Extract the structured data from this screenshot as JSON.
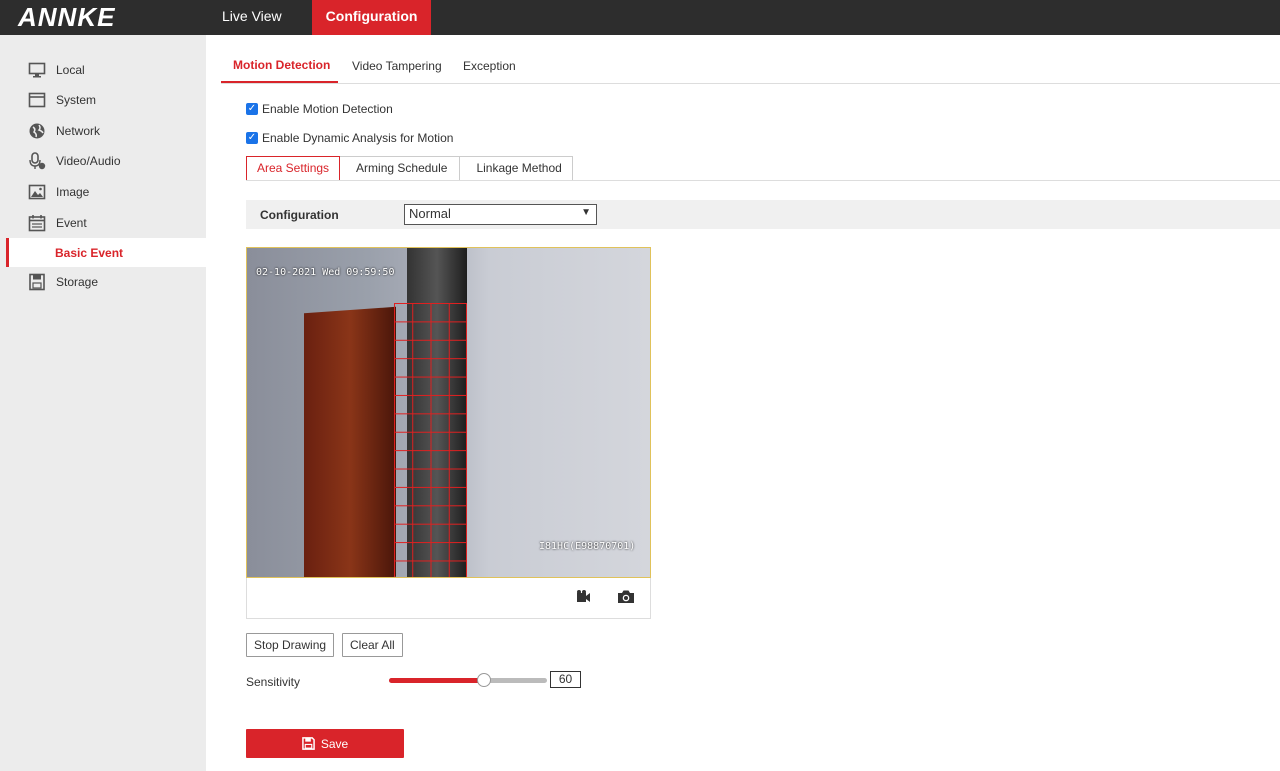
{
  "brand": {
    "logo": "ANNKE"
  },
  "topnav": {
    "live_view": "Live View",
    "configuration": "Configuration"
  },
  "sidebar": {
    "items": [
      {
        "label": "Local",
        "icon": "monitor-icon"
      },
      {
        "label": "System",
        "icon": "system-window-icon"
      },
      {
        "label": "Network",
        "icon": "globe-icon"
      },
      {
        "label": "Video/Audio",
        "icon": "microphone-icon"
      },
      {
        "label": "Image",
        "icon": "image-icon"
      },
      {
        "label": "Event",
        "icon": "calendar-icon"
      }
    ],
    "sub_active": "Basic Event",
    "storage": "Storage"
  },
  "tabs": {
    "motion": "Motion Detection",
    "tampering": "Video Tampering",
    "exception": "Exception"
  },
  "checks": {
    "enable_motion": "Enable Motion Detection",
    "enable_dynamic": "Enable Dynamic Analysis for Motion"
  },
  "subtabs": {
    "area": "Area Settings",
    "arming": "Arming Schedule",
    "linkage": "Linkage Method"
  },
  "config": {
    "label": "Configuration",
    "value": "Normal"
  },
  "video": {
    "timestamp": "02-10-2021 Wed 09:59:50",
    "camera_name": "I81HC(E98870701)"
  },
  "controls": {
    "stop_drawing": "Stop Drawing",
    "clear_all": "Clear All"
  },
  "sensitivity": {
    "label": "Sensitivity",
    "value": "60",
    "percent": 60
  },
  "save": {
    "label": "Save"
  },
  "colors": {
    "accent": "#d9242a",
    "topbar": "#2d2d2d",
    "sidebar": "#ececec"
  }
}
